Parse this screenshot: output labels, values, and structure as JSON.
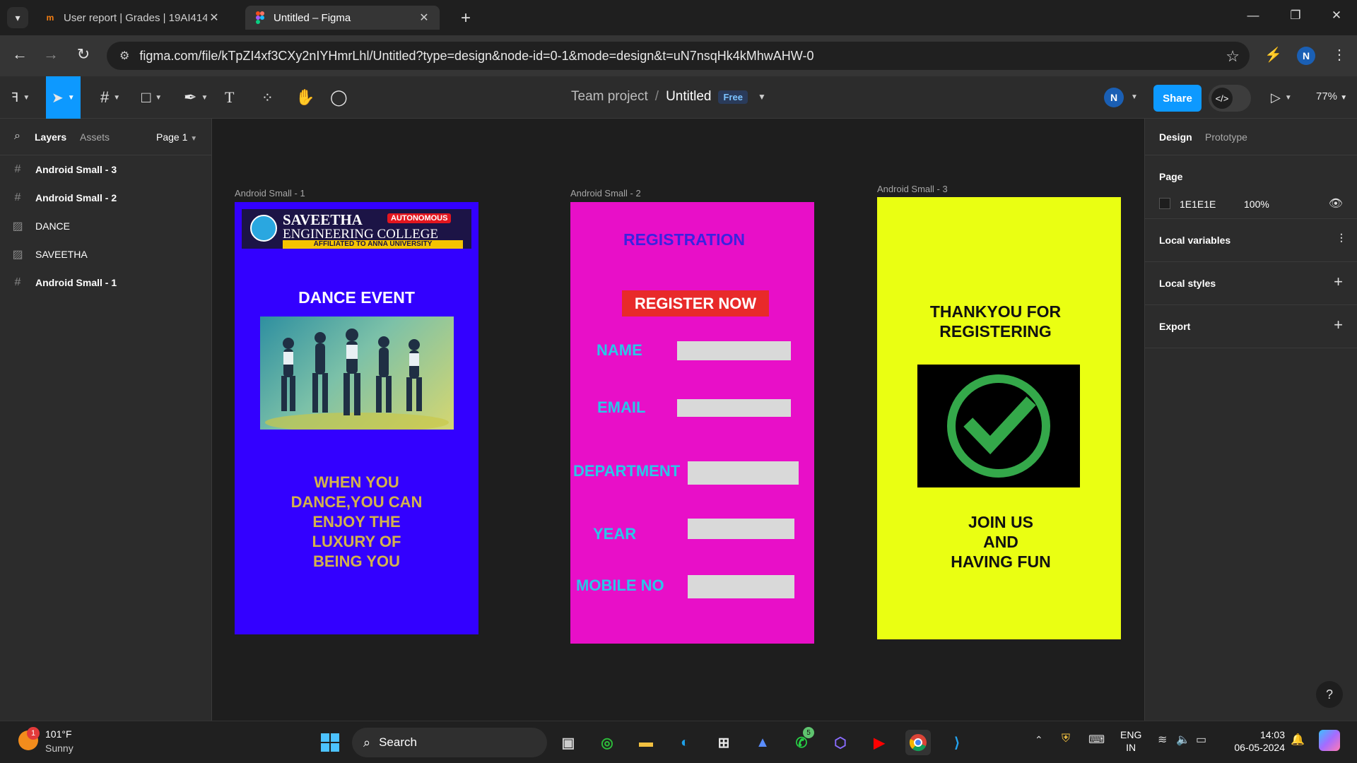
{
  "browser": {
    "tabs": [
      {
        "title": "User report | Grades | 19AI414-",
        "favicon": "moodle-icon",
        "active": false
      },
      {
        "title": "Untitled – Figma",
        "favicon": "figma-icon",
        "active": true
      }
    ],
    "url": "figma.com/file/kTpZI4xf3CXy2nIYHmrLhl/Untitled?type=design&node-id=0-1&mode=design&t=uN7nsqHk4kMhwAHW-0",
    "profile_initial": "N"
  },
  "figma": {
    "team": "Team project",
    "file": "Untitled",
    "plan_badge": "Free",
    "user_initial": "N",
    "share_label": "Share",
    "zoom": "77%"
  },
  "left_panel": {
    "tab_layers": "Layers",
    "tab_assets": "Assets",
    "page": "Page 1",
    "layers": [
      {
        "name": "Android Small - 3",
        "type": "frame"
      },
      {
        "name": "Android Small - 2",
        "type": "frame"
      },
      {
        "name": "DANCE",
        "type": "image"
      },
      {
        "name": "SAVEETHA",
        "type": "image"
      },
      {
        "name": "Android Small - 1",
        "type": "frame"
      }
    ]
  },
  "right_panel": {
    "tab_design": "Design",
    "tab_prototype": "Prototype",
    "page_label": "Page",
    "page_color": "1E1E1E",
    "page_opacity": "100%",
    "local_variables": "Local variables",
    "local_styles": "Local styles",
    "export": "Export"
  },
  "canvas": {
    "frame1": {
      "label": "Android Small - 1",
      "bg": "#3300ff",
      "logo_line1": "SAVEETHA",
      "logo_line2": "ENGINEERING COLLEGE",
      "logo_badge": "AUTONOMOUS",
      "logo_footer": "AFFILIATED TO ANNA UNIVERSITY",
      "title": "DANCE EVENT",
      "quote": [
        "WHEN YOU",
        "DANCE,YOU CAN",
        "ENJOY THE",
        "LUXURY OF",
        "BEING YOU"
      ]
    },
    "frame2": {
      "label": "Android Small - 2",
      "bg": "#e80fc8",
      "heading": "REGISTRATION",
      "button": "REGISTER NOW",
      "fields": [
        "NAME",
        "EMAIL",
        "DEPARTMENT",
        "YEAR",
        "MOBILE NO"
      ]
    },
    "frame3": {
      "label": "Android Small - 3",
      "bg": "#eaff12",
      "title_lines": [
        "THANKYOU FOR",
        "REGISTERING"
      ],
      "footer_lines": [
        "JOIN US",
        "AND",
        "HAVING FUN"
      ]
    }
  },
  "taskbar": {
    "weather_temp": "101°F",
    "weather_desc": "Sunny",
    "weather_badge": "1",
    "search_placeholder": "Search",
    "whatsapp_badge": "5",
    "lang_line1": "ENG",
    "lang_line2": "IN",
    "time": "14:03",
    "date": "06-05-2024"
  }
}
